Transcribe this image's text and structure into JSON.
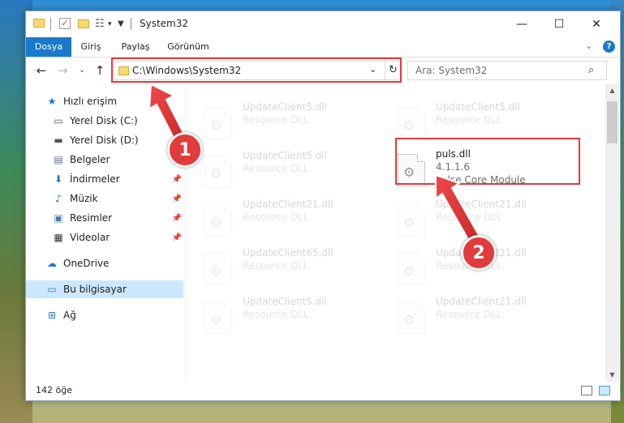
{
  "window": {
    "title": "System32"
  },
  "ribbon": {
    "tabs": [
      "Dosya",
      "Giriş",
      "Paylaş",
      "Görünüm"
    ],
    "active_tab": "Dosya"
  },
  "address": {
    "path": "C:\\Windows\\System32"
  },
  "search": {
    "placeholder": "Ara: System32"
  },
  "sidebar": {
    "items": [
      {
        "label": "Hızlı erişim",
        "icon": "star-icon"
      },
      {
        "label": "Yerel Disk (C:)",
        "icon": "drive-icon"
      },
      {
        "label": "Yerel Disk (D:)",
        "icon": "drive-icon"
      },
      {
        "label": "Belgeler",
        "icon": "documents-icon"
      },
      {
        "label": "İndirmeler",
        "icon": "download-icon"
      },
      {
        "label": "Müzik",
        "icon": "music-icon"
      },
      {
        "label": "Resimler",
        "icon": "pictures-icon"
      },
      {
        "label": "Videolar",
        "icon": "video-icon"
      },
      {
        "label": "OneDrive",
        "icon": "cloud-icon"
      },
      {
        "label": "Bu bilgisayar",
        "icon": "computer-icon"
      },
      {
        "label": "Ağ",
        "icon": "network-icon"
      }
    ]
  },
  "files": [
    {
      "name": "UpdateClient5.dll",
      "desc": "Resource DLL"
    },
    {
      "name": "UpdateClient5.dll",
      "desc": "Resource DLL"
    },
    {
      "name": "UpdateClient5.dll",
      "desc": "Resource DLL"
    },
    {
      "name": "puls.dll",
      "version": "4.1.1.6",
      "desc": "Pulse Core Module"
    },
    {
      "name": "UpdateClient21.dll",
      "desc": "Resource DLL"
    },
    {
      "name": "UpdateClient21.dll",
      "desc": "Resource DLL"
    },
    {
      "name": "UpdateClient65.dll",
      "desc": "Resource DLL"
    },
    {
      "name": "UpdateClient21.dll",
      "desc": "Resource DLL"
    },
    {
      "name": "UpdateClient5.dll",
      "desc": "Resource DLL"
    },
    {
      "name": "UpdateClient21.dll",
      "desc": "Resource DLL"
    }
  ],
  "status": {
    "count": "142 öğe"
  },
  "callouts": [
    "1",
    "2"
  ],
  "colors": {
    "accent": "#1979ca",
    "highlight": "#e13a3a",
    "selection": "#cce8ff"
  }
}
